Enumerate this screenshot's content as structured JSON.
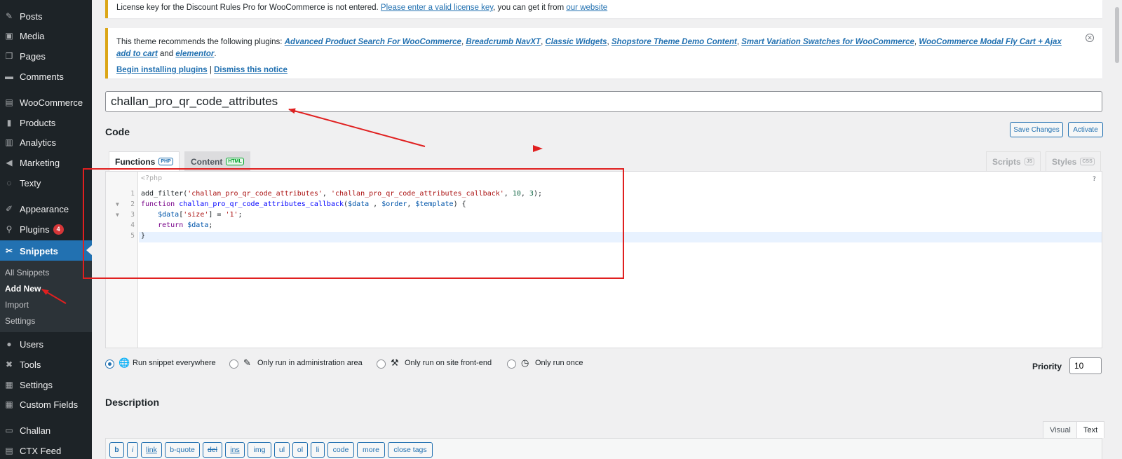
{
  "sidebar": {
    "items": [
      {
        "label": "Posts",
        "icon": "pushpin-icon",
        "glyph": "✎"
      },
      {
        "label": "Media",
        "icon": "media-icon",
        "glyph": "▣"
      },
      {
        "label": "Pages",
        "icon": "pages-icon",
        "glyph": "❐"
      },
      {
        "label": "Comments",
        "icon": "comments-icon",
        "glyph": "▬"
      },
      {
        "label": "WooCommerce",
        "icon": "woocommerce-icon",
        "glyph": "▤"
      },
      {
        "label": "Products",
        "icon": "products-icon",
        "glyph": "▮"
      },
      {
        "label": "Analytics",
        "icon": "analytics-icon",
        "glyph": "▥"
      },
      {
        "label": "Marketing",
        "icon": "marketing-icon",
        "glyph": "◀"
      },
      {
        "label": "Texty",
        "icon": "texty-icon",
        "glyph": "◌"
      },
      {
        "label": "Appearance",
        "icon": "appearance-icon",
        "glyph": "✐"
      },
      {
        "label": "Plugins",
        "icon": "plugins-icon",
        "glyph": "⚲",
        "badge": "4"
      },
      {
        "label": "Snippets",
        "icon": "snippets-icon",
        "glyph": "✂"
      },
      {
        "label": "Users",
        "icon": "users-icon",
        "glyph": "●"
      },
      {
        "label": "Tools",
        "icon": "tools-icon",
        "glyph": "✖"
      },
      {
        "label": "Settings",
        "icon": "settings-icon",
        "glyph": "▦"
      },
      {
        "label": "Custom Fields",
        "icon": "custom-fields-icon",
        "glyph": "▦"
      },
      {
        "label": "Challan",
        "icon": "challan-icon",
        "glyph": "▭"
      },
      {
        "label": "CTX Feed",
        "icon": "ctx-feed-icon",
        "glyph": "▤"
      }
    ],
    "submenu": [
      "All Snippets",
      "Add New",
      "Import",
      "Settings"
    ]
  },
  "notices": {
    "license": {
      "text": "License key for the Discount Rules Pro for WooCommerce is not entered.",
      "link1": "Please enter a valid license key",
      "middle": ", you can get it from",
      "link2": "our website"
    },
    "theme": {
      "prefix": "This theme recommends the following plugins:",
      "plugins": [
        "Advanced Product Search For WooCommerce",
        "Breadcrumb NavXT",
        "Classic Widgets",
        "Shopstore Theme Demo Content",
        "Smart Variation Swatches for WooCommerce",
        "WooCommerce Modal Fly Cart + Ajax add to cart"
      ],
      "and": "and",
      "last_plugin": "elementor",
      "action1": "Begin installing plugins",
      "separator": "|",
      "action2": "Dismiss this notice"
    }
  },
  "snippet_title": "challan_pro_qr_code_attributes",
  "code_heading": "Code",
  "buttons": {
    "save": "Save Changes",
    "activate": "Activate"
  },
  "tabs": {
    "functions": "Functions",
    "functions_tag": "PHP",
    "content": "Content",
    "content_tag": "HTML",
    "scripts": "Scripts",
    "scripts_tag": "JS",
    "styles": "Styles",
    "styles_tag": "CSS"
  },
  "editor": {
    "php_open": "<?php",
    "help": "?",
    "line_numbers": [
      "1",
      "2",
      "3",
      "4",
      "5"
    ]
  },
  "scope": {
    "options": [
      "Run snippet everywhere",
      "Only run in administration area",
      "Only run on site front-end",
      "Only run once"
    ],
    "selected": 0
  },
  "priority": {
    "label": "Priority",
    "value": "10"
  },
  "description": {
    "heading": "Description",
    "tabs": [
      "Visual",
      "Text"
    ],
    "toolbar": [
      "b",
      "i",
      "link",
      "b-quote",
      "del",
      "ins",
      "img",
      "ul",
      "ol",
      "li",
      "code",
      "more",
      "close tags"
    ]
  },
  "colors": {
    "accent": "#2271b1",
    "sidebar": "#1d2327",
    "annotation": "#e02020"
  }
}
